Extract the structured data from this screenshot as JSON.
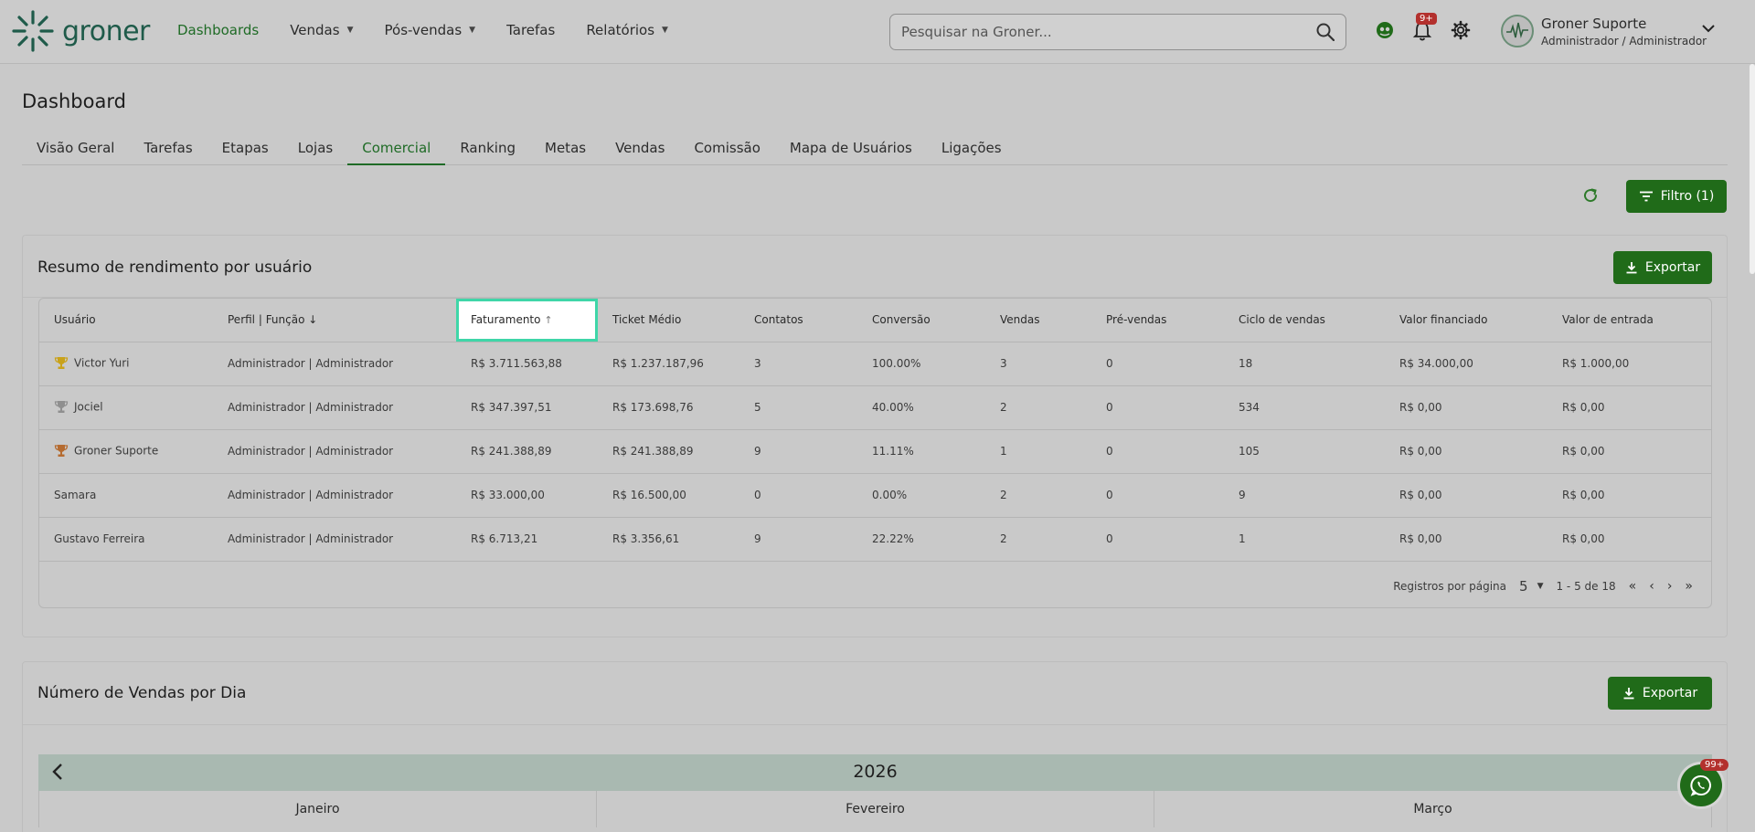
{
  "header": {
    "logo_text": "groner",
    "nav": [
      {
        "label": "Dashboards",
        "active": true,
        "has_caret": false
      },
      {
        "label": "Vendas",
        "has_caret": true
      },
      {
        "label": "Pós-vendas",
        "has_caret": true
      },
      {
        "label": "Tarefas",
        "has_caret": false
      },
      {
        "label": "Relatórios",
        "has_caret": true
      }
    ],
    "search_placeholder": "Pesquisar na Groner...",
    "notifications_badge": "9+",
    "user_name": "Groner Suporte",
    "user_role": "Administrador / Administrador"
  },
  "page": {
    "title": "Dashboard",
    "tabs": [
      "Visão Geral",
      "Tarefas",
      "Etapas",
      "Lojas",
      "Comercial",
      "Ranking",
      "Metas",
      "Vendas",
      "Comissão",
      "Mapa de Usuários",
      "Ligações"
    ],
    "active_tab": "Comercial",
    "filter_label": "Filtro (1)"
  },
  "summary": {
    "title": "Resumo de rendimento por usuário",
    "export_label": "Exportar",
    "columns": [
      "Usuário",
      "Perfil | Função",
      "Faturamento",
      "Ticket Médio",
      "Contatos",
      "Conversão",
      "Vendas",
      "Pré-vendas",
      "Ciclo de vendas",
      "Valor financiado",
      "Valor de entrada"
    ],
    "rows": [
      {
        "trophy": "gold",
        "cells": [
          "Victor Yuri",
          "Administrador | Administrador",
          "R$ 3.711.563,88",
          "R$ 1.237.187,96",
          "3",
          "100.00%",
          "3",
          "0",
          "18",
          "R$ 34.000,00",
          "R$ 1.000,00"
        ]
      },
      {
        "trophy": "silver",
        "cells": [
          "Jociel",
          "Administrador | Administrador",
          "R$ 347.397,51",
          "R$ 173.698,76",
          "5",
          "40.00%",
          "2",
          "0",
          "534",
          "R$ 0,00",
          "R$ 0,00"
        ]
      },
      {
        "trophy": "bronze",
        "cells": [
          "Groner Suporte",
          "Administrador | Administrador",
          "R$ 241.388,89",
          "R$ 241.388,89",
          "9",
          "11.11%",
          "1",
          "0",
          "105",
          "R$ 0,00",
          "R$ 0,00"
        ]
      },
      {
        "trophy": "",
        "cells": [
          "Samara",
          "Administrador | Administrador",
          "R$ 33.000,00",
          "R$ 16.500,00",
          "0",
          "0.00%",
          "2",
          "0",
          "9",
          "R$ 0,00",
          "R$ 0,00"
        ]
      },
      {
        "trophy": "",
        "cells": [
          "Gustavo Ferreira",
          "Administrador | Administrador",
          "R$ 6.713,21",
          "R$ 3.356,61",
          "9",
          "22.22%",
          "2",
          "0",
          "1",
          "R$ 0,00",
          "R$ 0,00"
        ]
      }
    ],
    "pager": {
      "label": "Registros por página",
      "per_page": "5",
      "range": "1 - 5 de 18"
    }
  },
  "sales_per_day": {
    "title": "Número de Vendas por Dia",
    "export_label": "Exportar",
    "year": "2026",
    "months": [
      "Janeiro",
      "Fevereiro",
      "Março"
    ]
  },
  "whatsapp_badge": "99+",
  "colors": {
    "brand_green": "#206b19",
    "highlight": "#3fd6a8",
    "badge_red": "#b3302d"
  }
}
